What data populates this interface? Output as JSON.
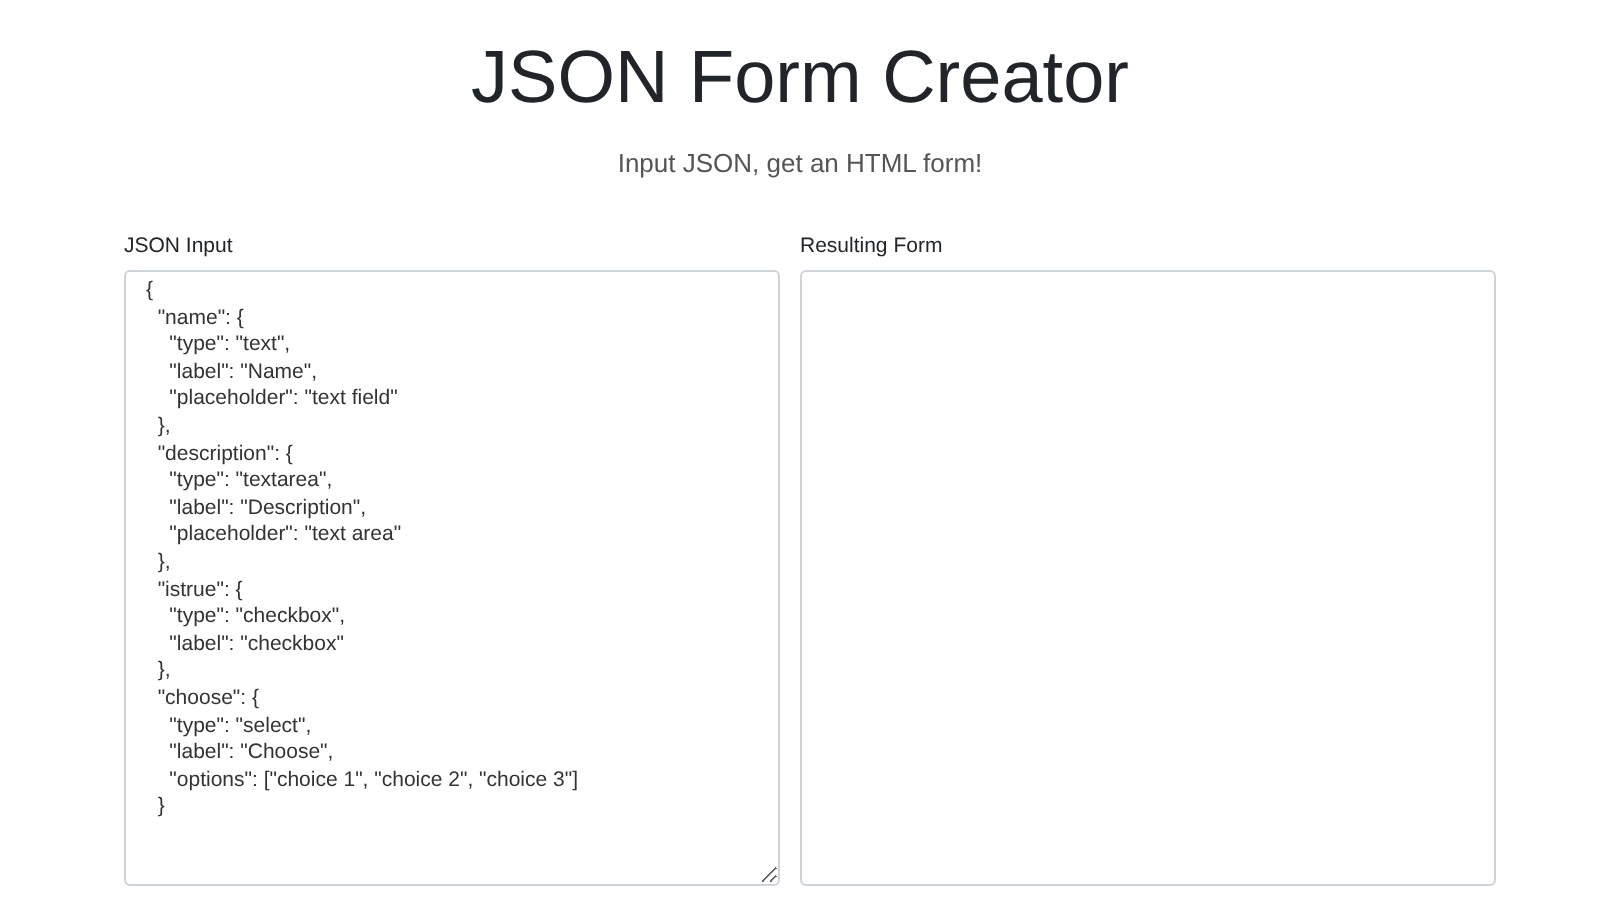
{
  "header": {
    "title": "JSON Form Creator",
    "subtitle": "Input JSON, get an HTML form!"
  },
  "json_input": {
    "label": "JSON Input",
    "value": "{\n  \"name\": {\n    \"type\": \"text\",\n    \"label\": \"Name\",\n    \"placeholder\": \"text field\"\n  },\n  \"description\": {\n    \"type\": \"textarea\",\n    \"label\": \"Description\",\n    \"placeholder\": \"text area\"\n  },\n  \"istrue\": {\n    \"type\": \"checkbox\",\n    \"label\": \"checkbox\"\n  },\n  \"choose\": {\n    \"type\": \"select\",\n    \"label\": \"Choose\",\n    \"options\": [\"choice 1\", \"choice 2\", \"choice 3\"]\n  }"
  },
  "resulting_form": {
    "label": "Resulting Form"
  }
}
